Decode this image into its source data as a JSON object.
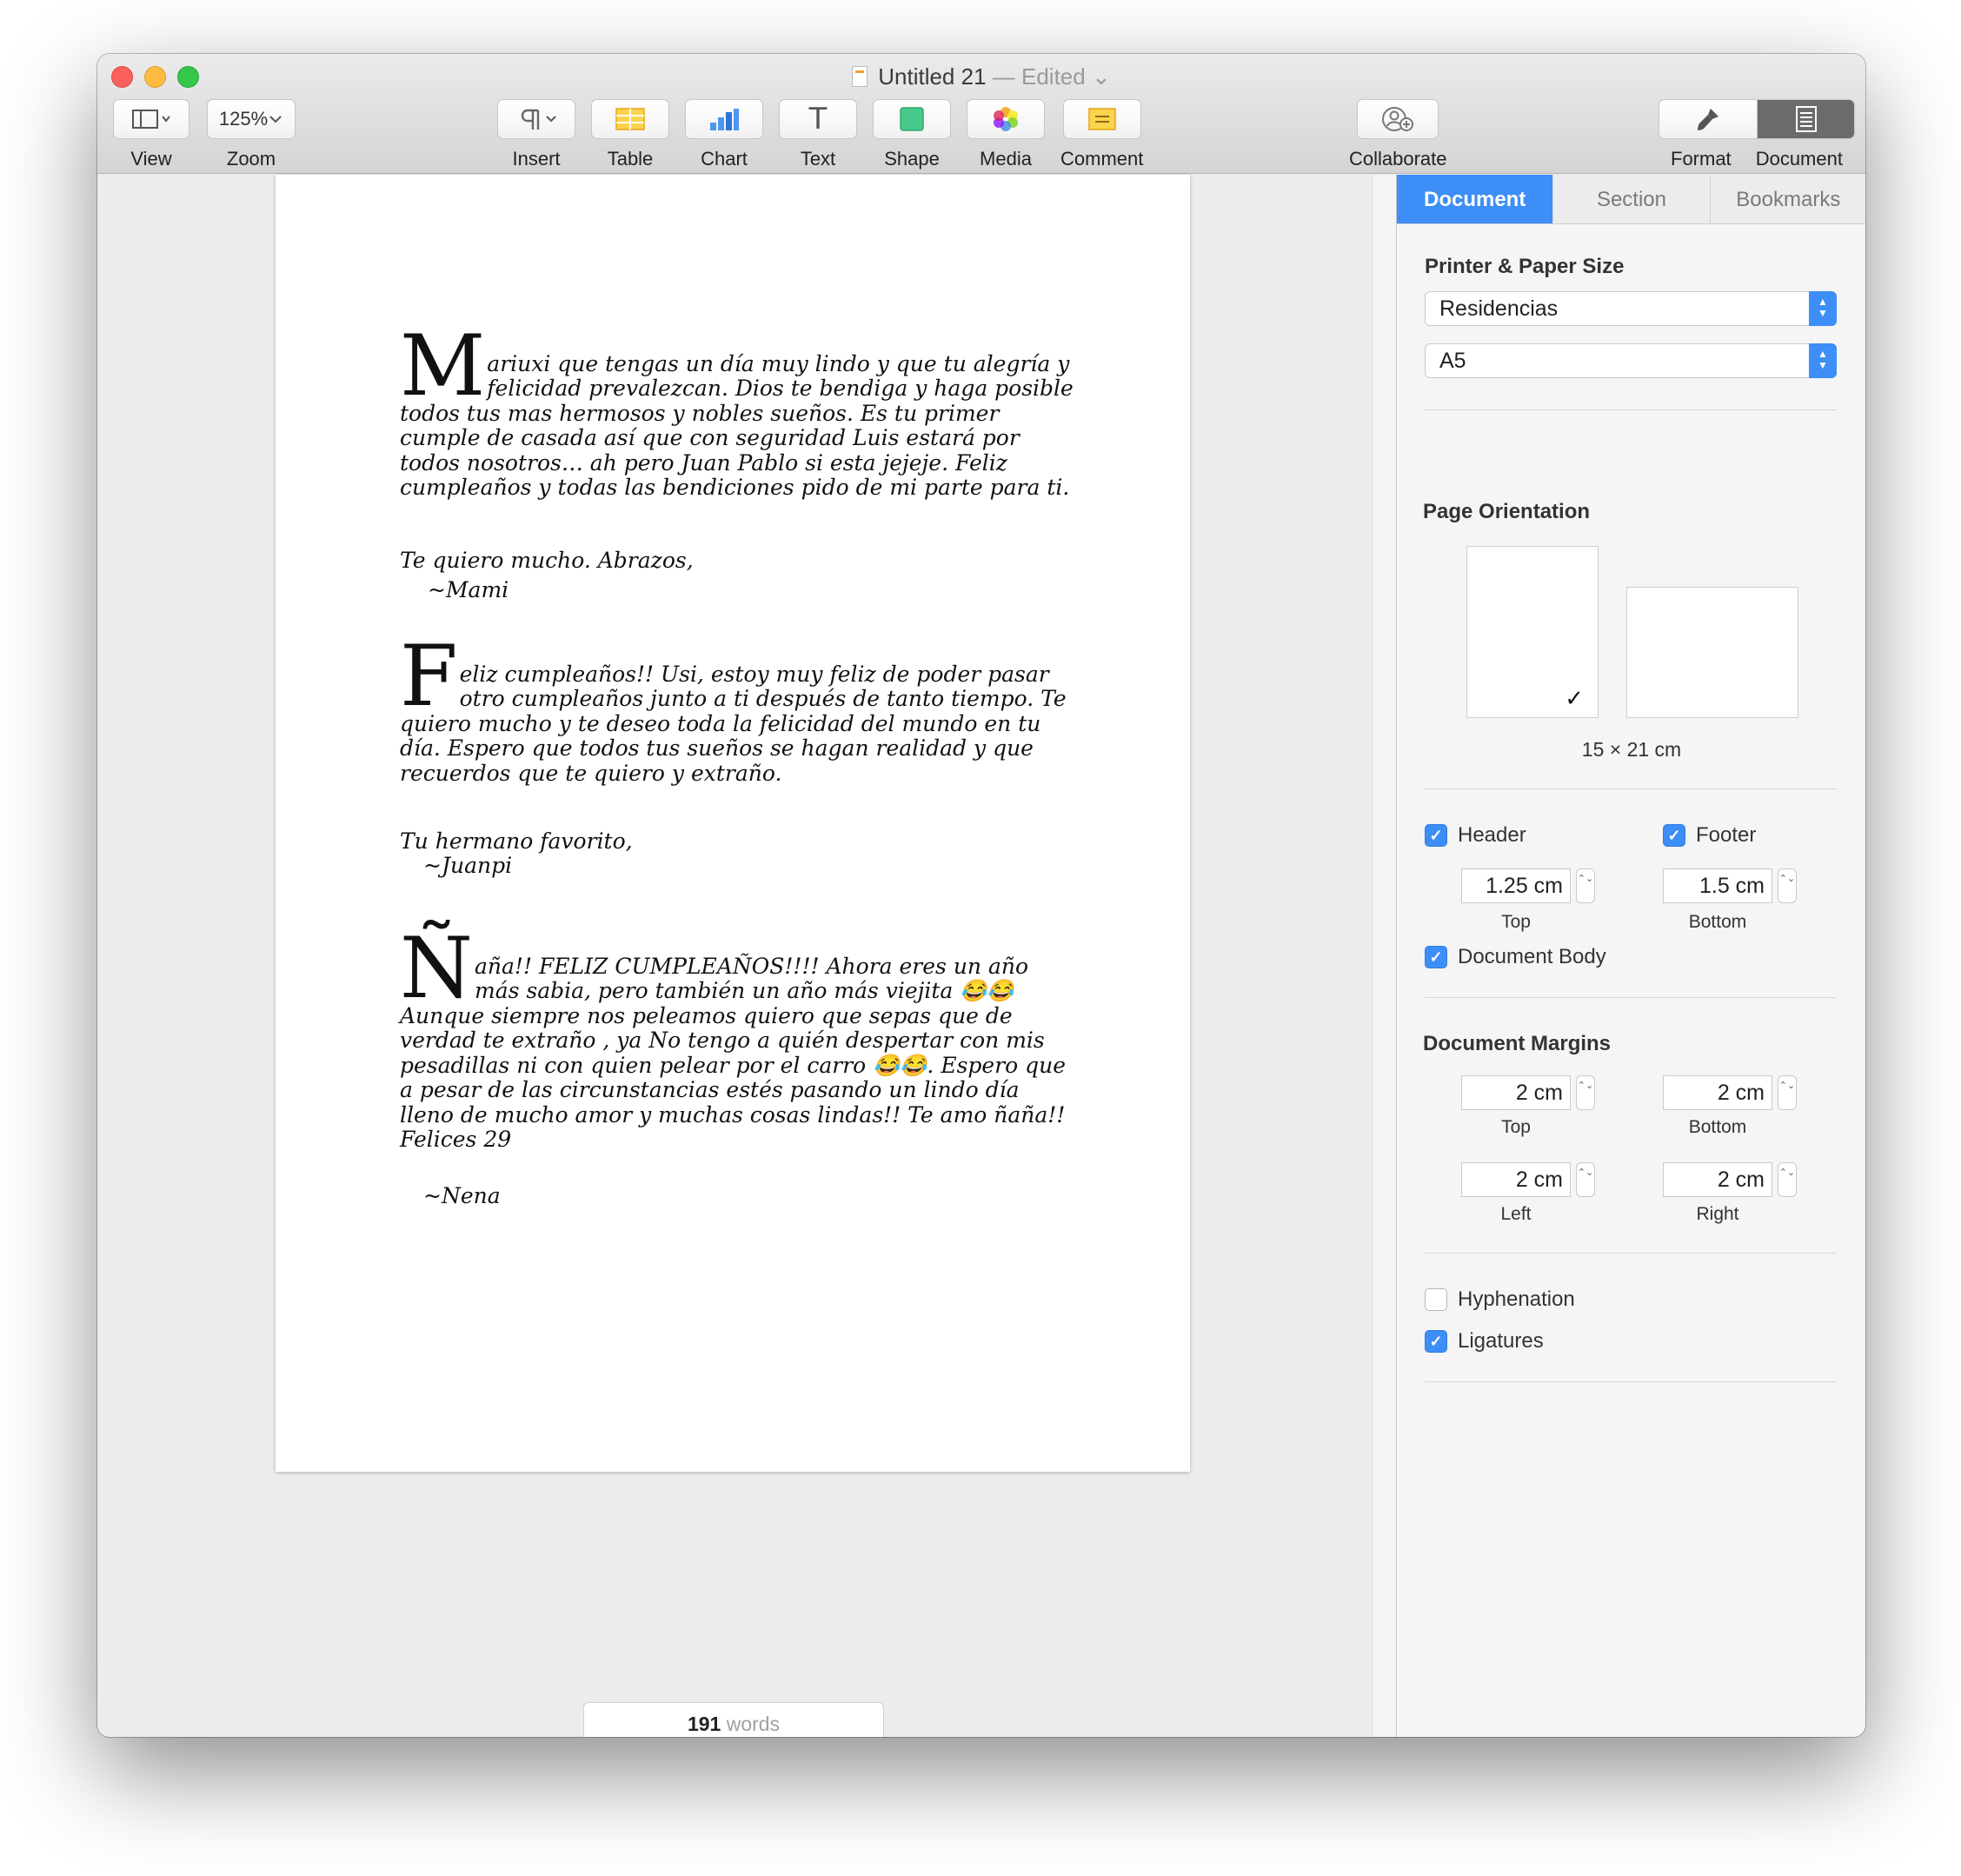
{
  "window": {
    "title": "Untitled 21",
    "edited": "— Edited",
    "dropdown_glyph": "⌄"
  },
  "toolbar": {
    "view_label": "View",
    "zoom_value": "125%",
    "zoom_label": "Zoom",
    "insert_label": "Insert",
    "table_label": "Table",
    "chart_label": "Chart",
    "text_label": "Text",
    "text_glyph": "T",
    "shape_label": "Shape",
    "media_label": "Media",
    "comment_label": "Comment",
    "collaborate_label": "Collaborate",
    "format_label": "Format",
    "document_label": "Document"
  },
  "document": {
    "p1_cap": "M",
    "p1": "ariuxi que tengas un día muy lindo y que tu alegría y felicidad prevalezcan. Dios te bendiga y haga posible todos tus mas hermosos y nobles sueños. Es tu primer cumple de casada así que con seguridad Luis estará por todos nosotros… ah pero Juan Pablo si esta jejeje. Feliz cumpleaños y todas las bendiciones pido de mi parte para ti.",
    "p1_close": "Te quiero mucho. Abrazos,",
    "p1_sign": "~Mami",
    "p2_cap": "F",
    "p2": "eliz cumpleaños!! Usi, estoy muy feliz de poder pasar otro cumpleaños junto a ti después de tanto tiempo. Te quiero mucho y te deseo toda la felicidad del mundo en tu día. Espero que todos tus sueños se hagan realidad y que recuerdos que te quiero y extraño.",
    "p2_close": "Tu hermano favorito,",
    "p2_sign": "~Juanpi",
    "p3_cap": "Ñ",
    "p3": "aña!! FELIZ CUMPLEAÑOS!!!! Ahora eres un año más sabia, pero también un año más viejita 😂😂 Aunque siempre nos peleamos quiero que sepas que de verdad te extraño , ya No tengo a quién despertar con mis pesadillas ni con quien pelear por el carro 😂😂. Espero que a pesar de las circunstancias estés pasando un lindo día lleno de mucho amor y muchas cosas lindas!! Te amo ñaña!! Felices 29",
    "p3_sign": "~Nena"
  },
  "status": {
    "word_count": "191",
    "word_label": "words"
  },
  "inspector": {
    "tabs": [
      "Document",
      "Section",
      "Bookmarks"
    ],
    "printer_title": "Printer & Paper Size",
    "printer_value": "Residencias",
    "paper_value": "A5",
    "orientation_title": "Page Orientation",
    "check_glyph": "✓",
    "page_size": "15 × 21 cm",
    "header_label": "Header",
    "footer_label": "Footer",
    "header_value": "1.25 cm",
    "footer_value": "1.5 cm",
    "top_label": "Top",
    "bottom_label": "Bottom",
    "left_label": "Left",
    "right_label": "Right",
    "body_label": "Document Body",
    "margins_title": "Document Margins",
    "margin_top": "2 cm",
    "margin_bottom": "2 cm",
    "margin_left": "2 cm",
    "margin_right": "2 cm",
    "hyphenation_label": "Hyphenation",
    "ligatures_label": "Ligatures",
    "stepper_glyph": "⌃⌄"
  },
  "icons": {
    "view": "sidebar-layout-icon",
    "insert": "pilcrow-icon",
    "table": "table-icon",
    "chart": "bar-chart-icon",
    "text": "text-box-icon",
    "shape": "shape-square-icon",
    "media": "photos-icon",
    "comment": "comment-note-icon",
    "collaborate": "add-person-icon",
    "format": "paintbrush-icon",
    "document": "document-icon"
  },
  "colors": {
    "accent": "#3d8ef7",
    "close": "#fc605b",
    "minimize": "#fdbc40",
    "zoom": "#34c84a"
  }
}
